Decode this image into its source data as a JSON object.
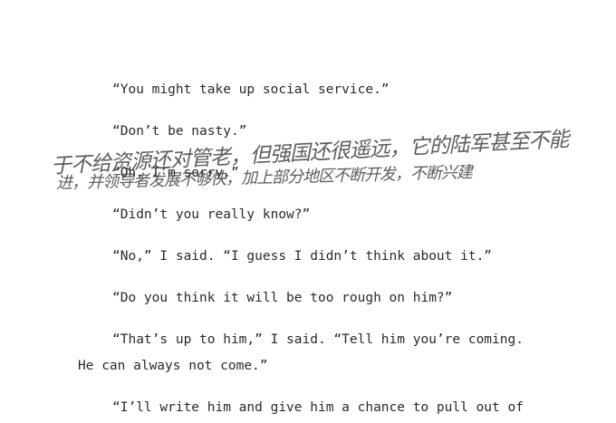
{
  "document": {
    "paragraphs": [
      "“You might take up social service.”",
      "“Don’t be nasty.”",
      "“Oh, I’m sorry.”",
      "“Didn’t you really know?”",
      "“No,” I said. “I guess I didn’t think about it.”",
      "“Do you think it will be too rough on him?”",
      "“That’s up to him,” I said. “Tell him you’re coming.",
      "He can always not come.”",
      "“I’ll write him and give him a chance to pull out of"
    ]
  },
  "overlay": {
    "handwritten_line_1": "于不给资源还对管老，但强国还很遥远，它的陆军甚至不能",
    "handwritten_line_2": "进，并领导者发展不够快，加上部分地区不断开发，不断兴建"
  }
}
